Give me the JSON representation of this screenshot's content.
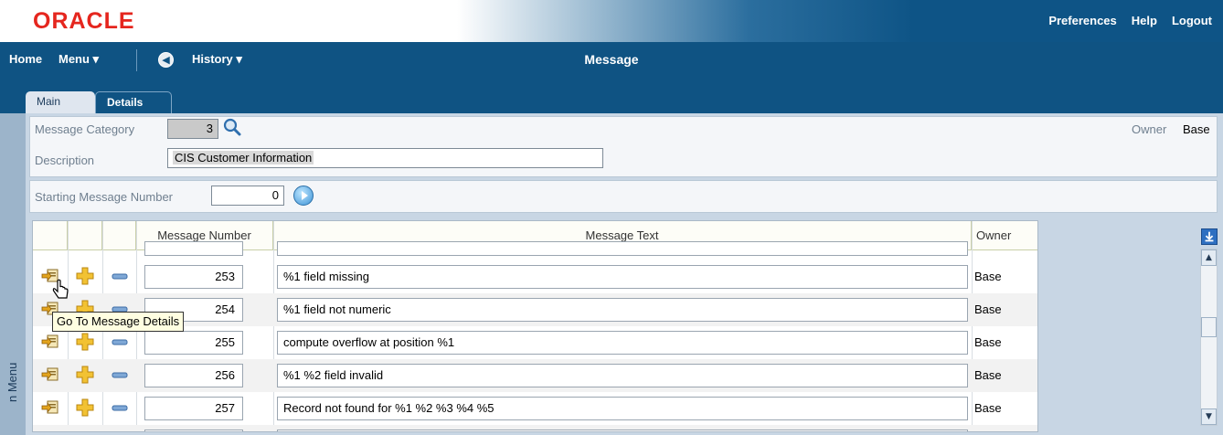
{
  "brand": {
    "logo": "ORACLE",
    "logo_color": "#e5261e"
  },
  "toplinks": {
    "preferences": "Preferences",
    "help": "Help",
    "logout": "Logout"
  },
  "nav": {
    "home": "Home",
    "menu": "Menu ▾",
    "history": "History ▾",
    "title": "Message"
  },
  "tabs": {
    "main": "Main",
    "details": "Details"
  },
  "sidemenu": {
    "label": "n Menu"
  },
  "form": {
    "category_label": "Message Category",
    "category_value": "3",
    "description_label": "Description",
    "description_value": "CIS Customer Information",
    "owner_label": "Owner",
    "owner_value": "Base",
    "start_label": "Starting Message Number",
    "start_value": "0"
  },
  "grid": {
    "headers": {
      "number": "Message Number",
      "text": "Message Text",
      "owner": "Owner"
    },
    "rows": [
      {
        "number": "253",
        "text": "%1 field missing",
        "owner": "Base"
      },
      {
        "number": "254",
        "text": "%1 field not numeric",
        "owner": "Base"
      },
      {
        "number": "255",
        "text": "compute overflow at position %1",
        "owner": "Base"
      },
      {
        "number": "256",
        "text": "%1 %2 field invalid",
        "owner": "Base"
      },
      {
        "number": "257",
        "text": "Record not found for %1 %2 %3 %4 %5",
        "owner": "Base"
      }
    ]
  },
  "tooltip": "Go To Message Details",
  "colors": {
    "navbar": "#0f5383",
    "accent_blue": "#2d6fc1"
  }
}
